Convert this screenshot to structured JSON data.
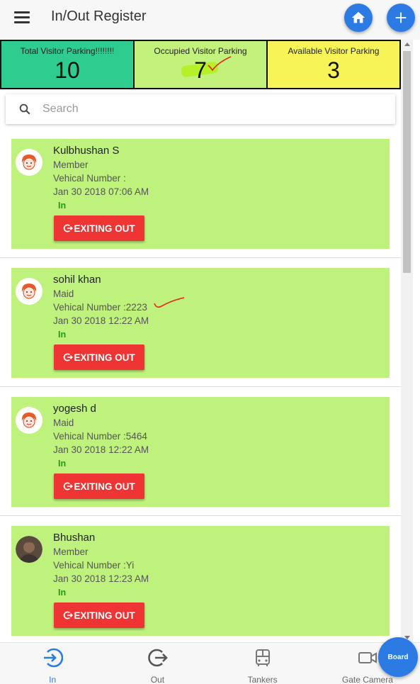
{
  "header": {
    "title": "In/Out Register",
    "menu_icon": "menu-icon",
    "home_icon": "home-icon",
    "add_icon": "plus-icon"
  },
  "stats": [
    {
      "label": "Total Visitor Parking!!!!!!!!",
      "value": "10",
      "color": "#2ecc8f"
    },
    {
      "label": "Occupied Visitor Parking",
      "value": "7",
      "color": "#c3f27c"
    },
    {
      "label": "Available Visitor Parking",
      "value": "3",
      "color": "#f6f456"
    }
  ],
  "search": {
    "placeholder": "Search",
    "value": ""
  },
  "entries": [
    {
      "name": "Kulbhushan S",
      "role": "Member",
      "vehicle": "Vehical Number :",
      "time": "Jan 30 2018 07:06 AM",
      "status": "In",
      "button": "EXITING OUT",
      "avatar": "cartoon-avatar"
    },
    {
      "name": "sohil khan",
      "role": "Maid",
      "vehicle": "Vehical Number :2223",
      "time": "Jan 30 2018 12:22 AM",
      "status": "In",
      "button": "EXITING OUT",
      "avatar": "cartoon-avatar"
    },
    {
      "name": "yogesh d",
      "role": "Maid",
      "vehicle": "Vehical Number :5464",
      "time": "Jan 30 2018 12:22 AM",
      "status": "In",
      "button": "EXITING OUT",
      "avatar": "cartoon-avatar"
    },
    {
      "name": "Bhushan",
      "role": "Member",
      "vehicle": "Vehical Number :Yi",
      "time": "Jan 30 2018 12:23 AM",
      "status": "In",
      "button": "EXITING OUT",
      "avatar": "photo-avatar"
    }
  ],
  "tabs": [
    {
      "label": "In",
      "icon": "login-icon",
      "active": true
    },
    {
      "label": "Out",
      "icon": "logout-icon",
      "active": false
    },
    {
      "label": "Tankers",
      "icon": "bus-icon",
      "active": false
    },
    {
      "label": "Gate Camera",
      "icon": "video-camera-icon",
      "active": false
    }
  ],
  "board_button": {
    "label": "Board"
  },
  "colors": {
    "accent": "#2c7be5",
    "card": "#bff27c",
    "danger": "#ef3434",
    "status_in": "#1b9c1b"
  }
}
